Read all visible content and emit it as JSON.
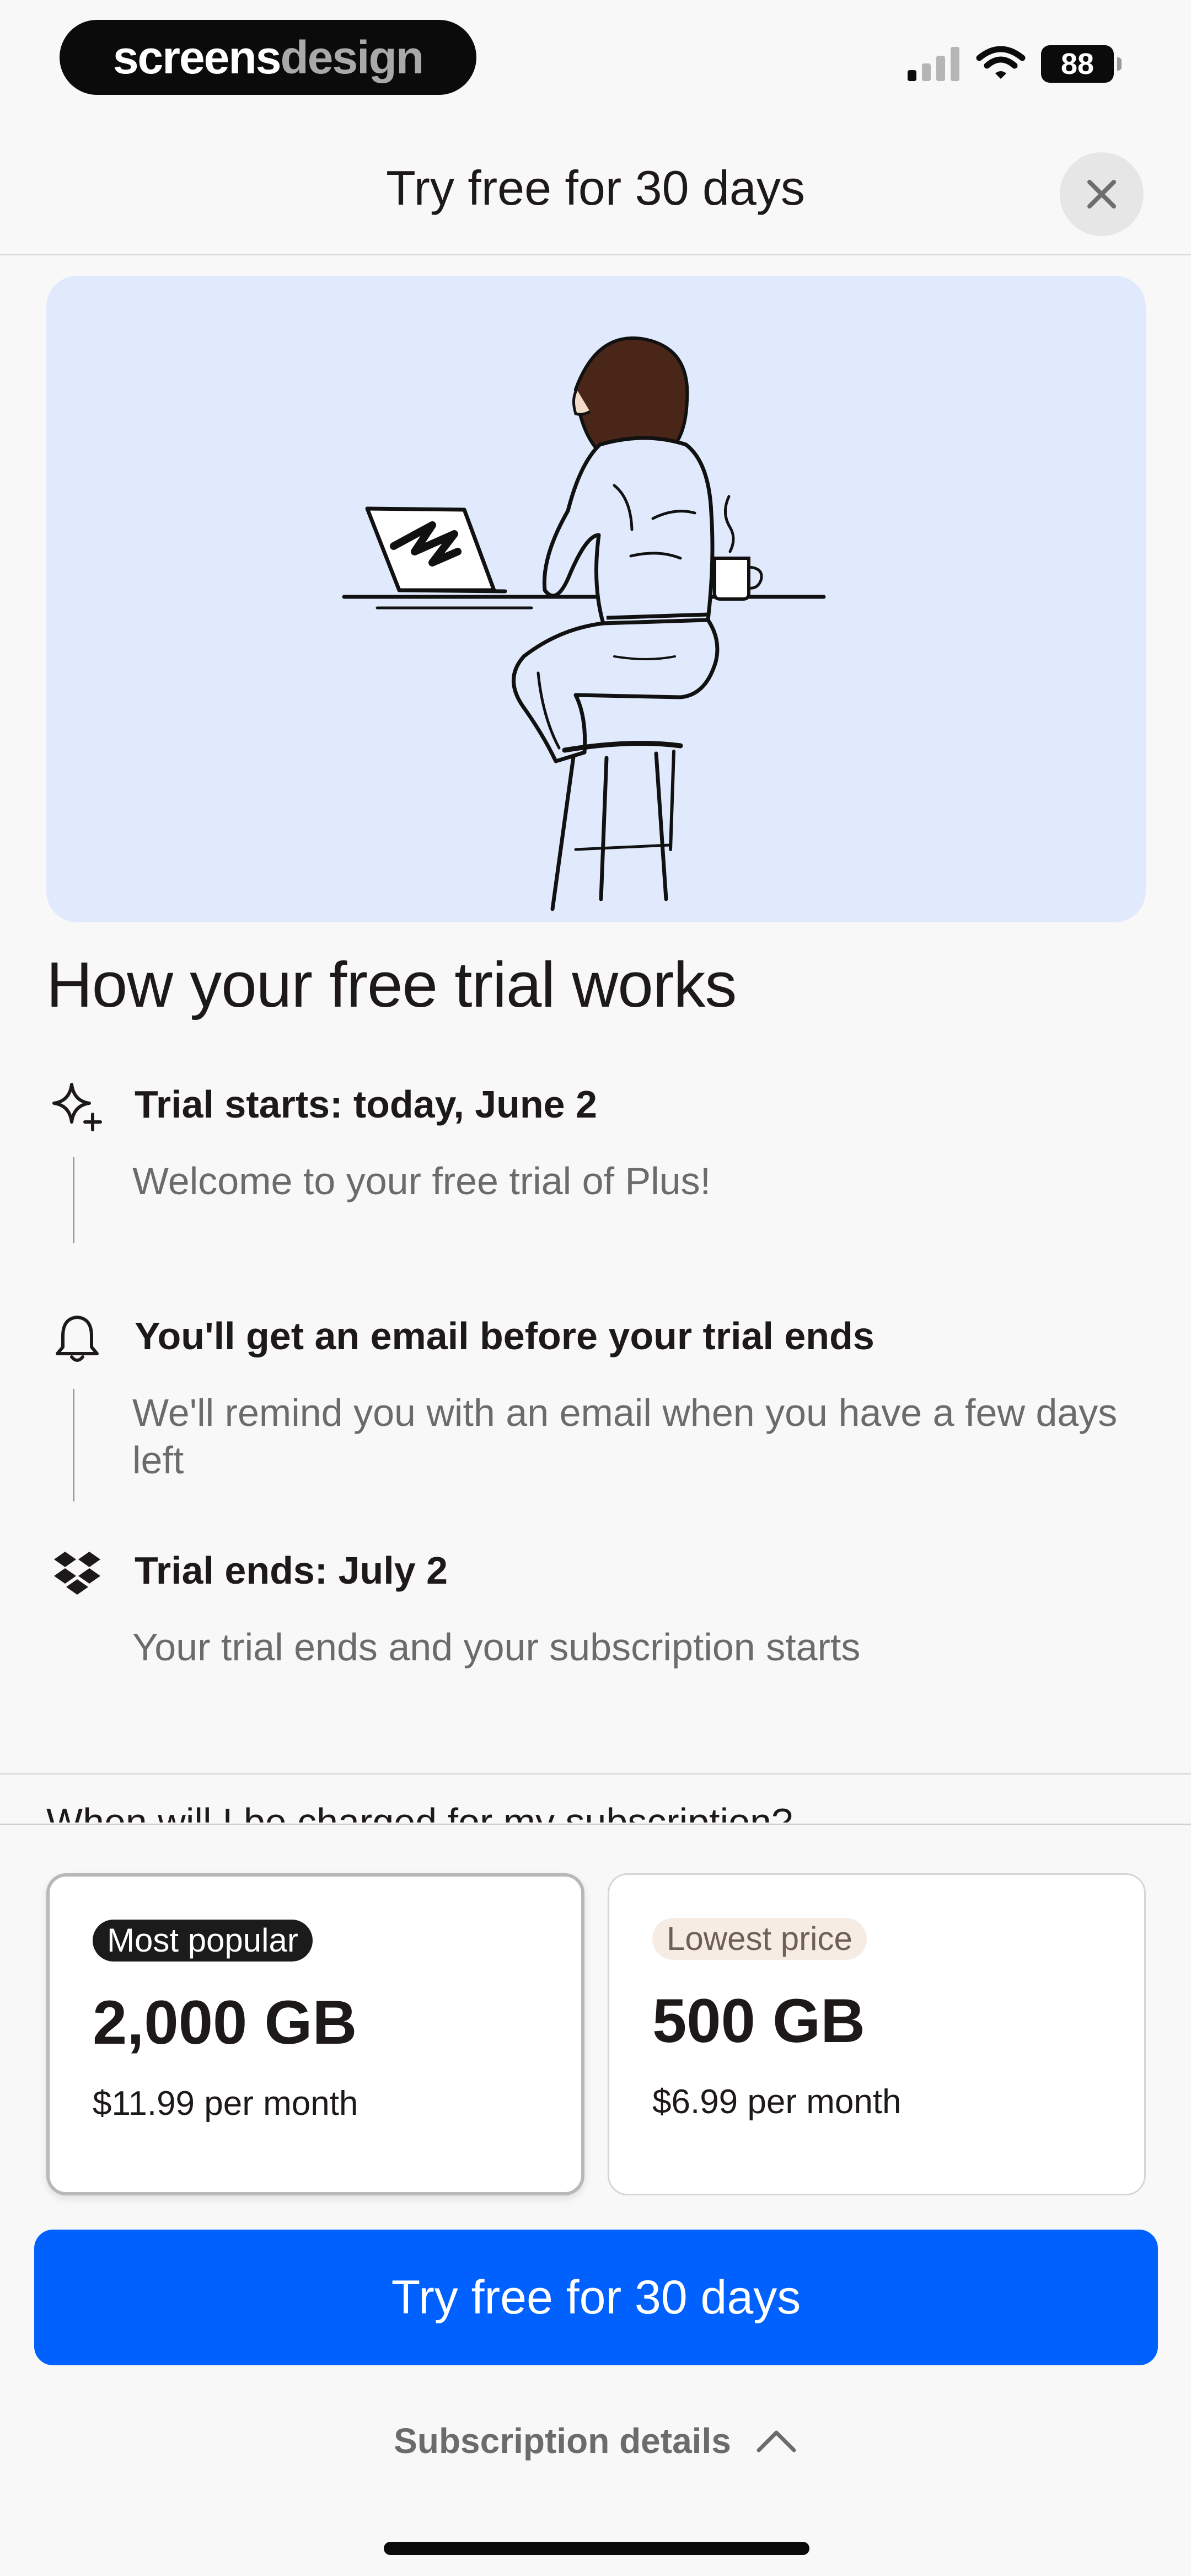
{
  "status_bar": {
    "brand_part1": "screens",
    "brand_part2": "design",
    "battery": "88",
    "icons": [
      "signal-icon",
      "wifi-icon",
      "battery-icon"
    ]
  },
  "header": {
    "title": "Try free for 30 days",
    "close_icon": "close-icon"
  },
  "hero": {
    "illustration": "woman-at-laptop-illustration",
    "background": "#e1eafd"
  },
  "how_it_works": {
    "title": "How your free trial works",
    "steps": [
      {
        "icon": "sparkle-icon",
        "title": "Trial starts: today, June 2",
        "description": "Welcome to your free trial of Plus!"
      },
      {
        "icon": "bell-icon",
        "title": "You'll get an email before your trial ends",
        "description": "We'll remind you with an email when you have a few days left"
      },
      {
        "icon": "dropbox-icon",
        "title": "Trial ends: July 2",
        "description": "Your trial ends and your subscription starts"
      }
    ]
  },
  "peek_text": "When will I be charged for my subscription?",
  "plans": [
    {
      "badge": "Most popular",
      "size": "2,000 GB",
      "price": "$11.99 per month",
      "selected": true
    },
    {
      "badge": "Lowest price",
      "size": "500 GB",
      "price": "$6.99 per month",
      "selected": false
    }
  ],
  "cta_label": "Try free for 30 days",
  "subscription_details": "Subscription details",
  "colors": {
    "accent": "#0061fe",
    "text": "#1e1919",
    "muted": "#6b6b6b"
  }
}
